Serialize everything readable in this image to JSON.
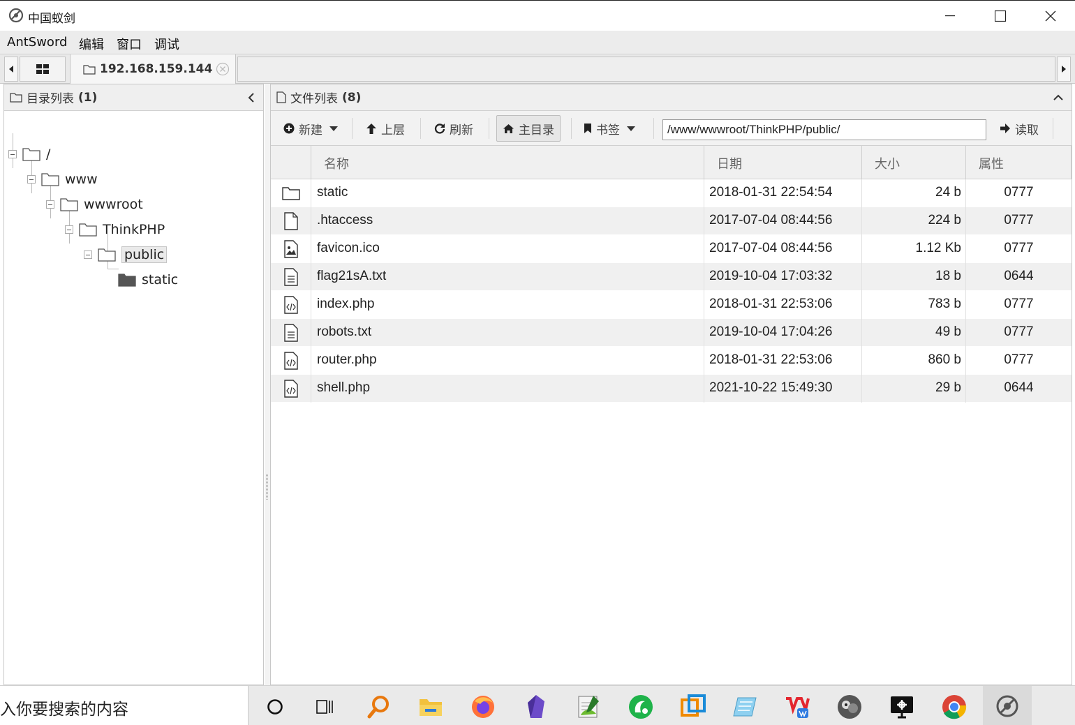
{
  "window": {
    "title": "中国蚁剑"
  },
  "menu": {
    "items": [
      "AntSword",
      "编辑",
      "窗口",
      "调试"
    ]
  },
  "tabs": {
    "active_label": "192.168.159.144"
  },
  "dir_panel": {
    "title": "目录列表",
    "count": "(1)",
    "tree": [
      {
        "label": "/",
        "expanded": true
      },
      {
        "label": "www",
        "expanded": true
      },
      {
        "label": "wwwroot",
        "expanded": true
      },
      {
        "label": "ThinkPHP",
        "expanded": true
      },
      {
        "label": "public",
        "expanded": true,
        "selected": true
      },
      {
        "label": "static",
        "expanded": false
      }
    ]
  },
  "file_panel": {
    "title": "文件列表",
    "count": "(8)",
    "toolbar": {
      "new_label": "新建",
      "up_label": "上层",
      "refresh_label": "刷新",
      "home_label": "主目录",
      "bookmark_label": "书签",
      "path_value": "/www/wwwroot/ThinkPHP/public/",
      "read_label": "读取"
    },
    "columns": {
      "name": "名称",
      "date": "日期",
      "size": "大小",
      "attr": "属性"
    },
    "files": [
      {
        "icon": "folder-icon",
        "name": "static",
        "date": "2018-01-31 22:54:54",
        "size": "24 b",
        "attr": "0777"
      },
      {
        "icon": "file-icon",
        "name": ".htaccess",
        "date": "2017-07-04 08:44:56",
        "size": "224 b",
        "attr": "0777"
      },
      {
        "icon": "image-file-icon",
        "name": "favicon.ico",
        "date": "2017-07-04 08:44:56",
        "size": "1.12 Kb",
        "attr": "0777"
      },
      {
        "icon": "text-file-icon",
        "name": "flag21sA.txt",
        "date": "2019-10-04 17:03:32",
        "size": "18 b",
        "attr": "0644"
      },
      {
        "icon": "code-file-icon",
        "name": "index.php",
        "date": "2018-01-31 22:53:06",
        "size": "783 b",
        "attr": "0777"
      },
      {
        "icon": "text-file-icon",
        "name": "robots.txt",
        "date": "2019-10-04 17:04:26",
        "size": "49 b",
        "attr": "0777"
      },
      {
        "icon": "code-file-icon",
        "name": "router.php",
        "date": "2018-01-31 22:53:06",
        "size": "860 b",
        "attr": "0777"
      },
      {
        "icon": "code-file-icon",
        "name": "shell.php",
        "date": "2021-10-22 15:49:30",
        "size": "29 b",
        "attr": "0644"
      }
    ]
  },
  "taskbar": {
    "search_text": "入你要搜索的内容",
    "apps": [
      "cortana-icon",
      "task-view-icon",
      "search-tool-icon",
      "file-explorer-icon",
      "firefox-icon",
      "obsidian-icon",
      "notepad-plus-plus-icon",
      "green-app-icon",
      "virtualbox-icon",
      "notepad-icon",
      "wps-icon",
      "avatar-app-icon",
      "remote-desktop-icon",
      "chrome-icon",
      "antsword-icon"
    ]
  },
  "colors": {
    "row_alt": "#f0f0f0",
    "header_bg": "#efefef",
    "toolbar_bg": "#f2f2f2"
  }
}
